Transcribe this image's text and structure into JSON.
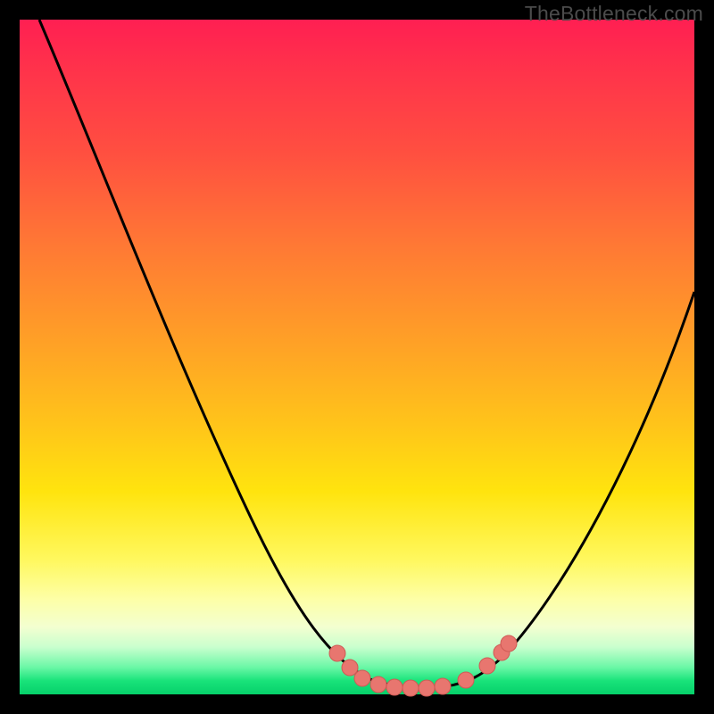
{
  "watermark": "TheBottleneck.com",
  "colors": {
    "frame": "#000000",
    "curve_stroke": "#000000",
    "marker_fill": "#e8766f",
    "marker_stroke": "#cf5a55",
    "gradient_stops": [
      "#ff1f52",
      "#ff2f4c",
      "#ff5040",
      "#ff7a34",
      "#ffa126",
      "#ffc41a",
      "#ffe40e",
      "#fff85e",
      "#fdffa8",
      "#f3ffd0",
      "#c9ffce",
      "#6af7a6",
      "#19e37a",
      "#06d06a"
    ]
  },
  "chart_data": {
    "type": "line",
    "title": "",
    "xlabel": "",
    "ylabel": "",
    "xlim": [
      0,
      100
    ],
    "ylim": [
      0,
      100
    ],
    "series": [
      {
        "name": "bottleneck-curve",
        "x": [
          3,
          6,
          10,
          15,
          20,
          25,
          30,
          35,
          40,
          45,
          48,
          50,
          52,
          55,
          58,
          60,
          62,
          65,
          68,
          72,
          76,
          80,
          85,
          90,
          95,
          100
        ],
        "y": [
          100,
          92,
          82,
          70,
          58,
          47,
          37,
          28,
          20,
          12,
          7,
          4,
          2,
          1,
          1,
          1,
          1,
          2,
          4,
          8,
          14,
          21,
          30,
          40,
          50,
          60
        ]
      }
    ],
    "markers": [
      {
        "x": 48,
        "y": 7
      },
      {
        "x": 50,
        "y": 4
      },
      {
        "x": 52,
        "y": 2
      },
      {
        "x": 55,
        "y": 1
      },
      {
        "x": 58,
        "y": 1
      },
      {
        "x": 60,
        "y": 1
      },
      {
        "x": 62,
        "y": 1
      },
      {
        "x": 65,
        "y": 2
      },
      {
        "x": 68,
        "y": 4
      },
      {
        "x": 70,
        "y": 6
      }
    ],
    "background_gradient": "red-yellow-green vertical (high=bad top, low=good bottom)"
  }
}
